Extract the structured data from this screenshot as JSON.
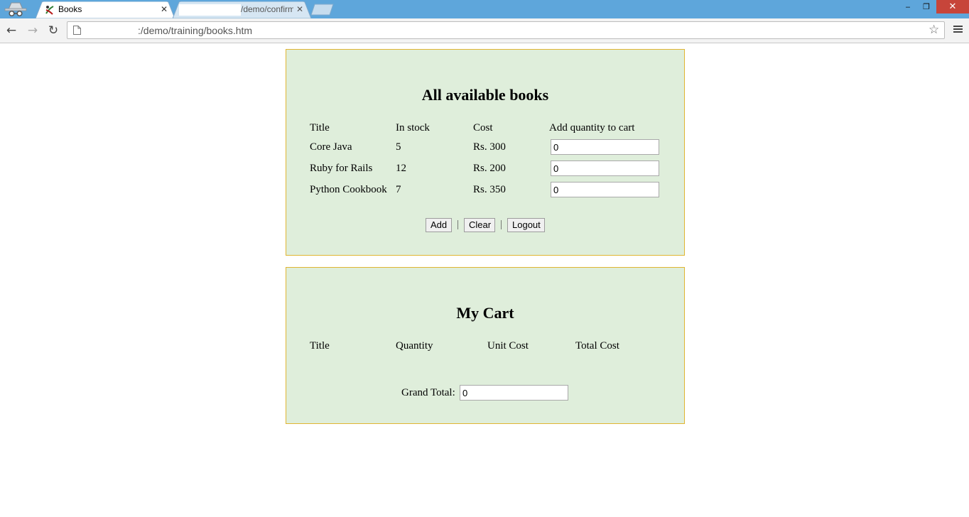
{
  "browser": {
    "tabs": [
      {
        "title": "Books",
        "active": true
      },
      {
        "title": "/demo/confirm",
        "active": false
      }
    ],
    "address": ":/demo/training/books.htm",
    "window_controls": {
      "minimize": "‒",
      "restore": "❐",
      "close": "✕"
    }
  },
  "books_panel": {
    "heading": "All available books",
    "columns": [
      "Title",
      "In stock",
      "Cost",
      "Add quantity to cart"
    ],
    "rows": [
      {
        "title": "Core Java",
        "stock": "5",
        "cost": "Rs. 300",
        "qty": "0"
      },
      {
        "title": "Ruby for Rails",
        "stock": "12",
        "cost": "Rs. 200",
        "qty": "0"
      },
      {
        "title": "Python Cookbook",
        "stock": "7",
        "cost": "Rs. 350",
        "qty": "0"
      }
    ],
    "buttons": {
      "add": "Add",
      "clear": "Clear",
      "logout": "Logout"
    },
    "separator": "|"
  },
  "cart_panel": {
    "heading": "My Cart",
    "columns": [
      "Title",
      "Quantity",
      "Unit Cost",
      "Total Cost"
    ],
    "grand_total_label": "Grand Total:",
    "grand_total_value": "0"
  },
  "colors": {
    "panel_bg": "#dfeedb",
    "panel_border": "#e0b532",
    "titlebar": "#5ea6db",
    "close_button": "#c7453a"
  }
}
